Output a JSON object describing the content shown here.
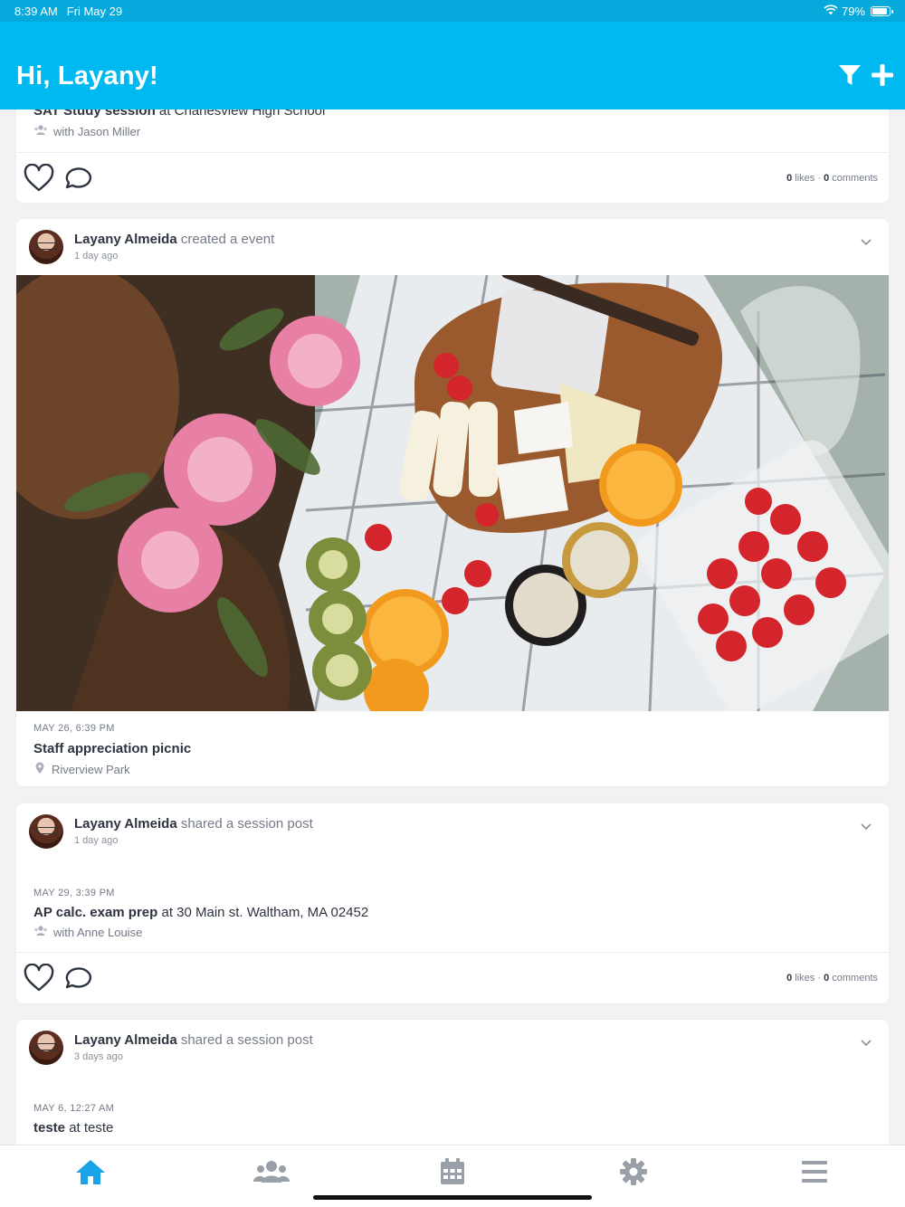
{
  "status": {
    "time": "8:39 AM",
    "date": "Fri May 29",
    "battery": "79%",
    "battery_level": 0.79
  },
  "header": {
    "greeting": "Hi, Layany!",
    "filter_icon": "filter-icon",
    "add_icon": "plus-icon"
  },
  "colors": {
    "header": "#00b9f0",
    "statusbar": "#05a9db",
    "accent": "#1aa3e8",
    "tab_inactive": "#9aa0a8"
  },
  "feed": {
    "post0": {
      "title_bold": "SAT Study session",
      "title_rest": " at Charlesview High School",
      "with": "with Jason Miller",
      "likes": "0",
      "likes_label": " likes · ",
      "comments": "0",
      "comments_label": " comments"
    },
    "post1": {
      "author": "Layany Almeida",
      "action": " created a event",
      "time": "1 day ago",
      "date": "MAY 26, 6:39 PM",
      "title": "Staff appreciation picnic",
      "location": "Riverview Park"
    },
    "post2": {
      "author": "Layany Almeida",
      "action": " shared a session post",
      "time": "1 day ago",
      "date": "MAY 29, 3:39 PM",
      "title_bold": "AP calc. exam prep",
      "title_rest": " at 30 Main st. Waltham, MA 02452",
      "with": "with Anne Louise",
      "likes": "0",
      "likes_label": " likes · ",
      "comments": "0",
      "comments_label": " comments"
    },
    "post3": {
      "author": "Layany Almeida",
      "action": " shared a session post",
      "time": "3 days ago",
      "date": "MAY 6, 12:27 AM",
      "title_bold": "teste",
      "title_rest": " at teste"
    }
  },
  "tabs": [
    {
      "name": "home",
      "icon": "home-icon",
      "active": true
    },
    {
      "name": "groups",
      "icon": "people-icon",
      "active": false
    },
    {
      "name": "calendar",
      "icon": "calendar-icon",
      "active": false
    },
    {
      "name": "settings",
      "icon": "gear-icon",
      "active": false
    },
    {
      "name": "menu",
      "icon": "hamburger-icon",
      "active": false
    }
  ]
}
